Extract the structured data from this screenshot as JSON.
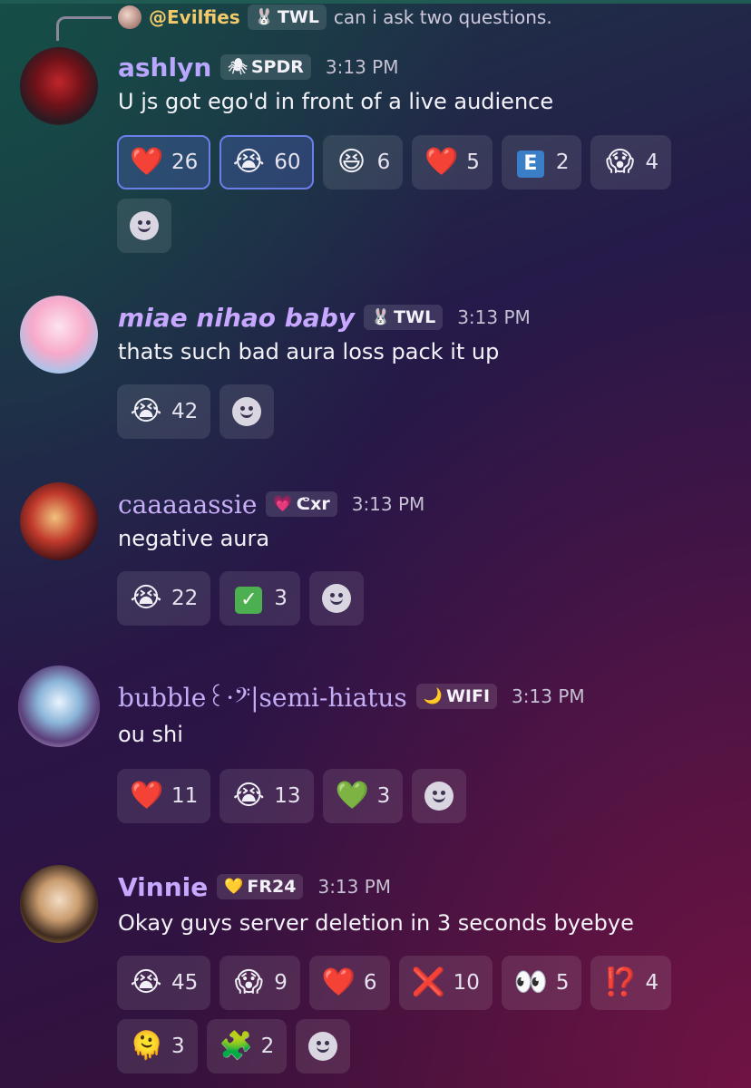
{
  "reply": {
    "username": "@Evilfies",
    "tag": "TWL",
    "tag_icon": "🐰",
    "text": "can i ask two questions."
  },
  "messages": [
    {
      "username": "ashlyn",
      "name_color": "#b9a6ff",
      "tag": "SPDR",
      "tag_icon": "🕷",
      "time": "3:13 PM",
      "text": "U js got ego'd in front of a live audience",
      "reactions": [
        {
          "emoji": "❤️",
          "icon": "red-heart",
          "count": "26",
          "active": true
        },
        {
          "emoji": "😭",
          "icon": "loudly-crying-face",
          "count": "60",
          "active": true
        },
        {
          "emoji": "😆",
          "icon": "grinning-squinting-face",
          "count": "6"
        },
        {
          "emoji": "❤️",
          "icon": "red-heart",
          "count": "5"
        },
        {
          "emoji": "E",
          "icon": "letter-e-badge",
          "count": "2"
        },
        {
          "emoji": "😱",
          "icon": "screaming-face",
          "count": "4"
        }
      ]
    },
    {
      "username": "miae nihao baby",
      "name_color": "#c7a7ff",
      "tag": "TWL",
      "tag_icon": "🐰",
      "time": "3:13 PM",
      "text": "thats such bad aura loss pack it up",
      "reactions": [
        {
          "emoji": "😭",
          "icon": "loudly-crying-face",
          "count": "42"
        }
      ]
    },
    {
      "username": "caaaaassie",
      "name_color": "#c8aef7",
      "tag": "ᕦxr",
      "tag_icon": "💗",
      "time": "3:13 PM",
      "text": "negative aura",
      "reactions": [
        {
          "emoji": "😭",
          "icon": "loudly-crying-face",
          "count": "22"
        },
        {
          "emoji": "✓",
          "icon": "check-mark-button",
          "count": "3"
        }
      ]
    },
    {
      "username": "bubble꒰·𝄢|semi-hiatus",
      "name_color": "#c3aef5",
      "tag": "WIFI",
      "tag_icon": "🌙",
      "time": "3:13 PM",
      "text": "ou shi",
      "reactions": [
        {
          "emoji": "❤️",
          "icon": "red-heart",
          "count": "11"
        },
        {
          "emoji": "😭",
          "icon": "loudly-crying-face",
          "count": "13"
        },
        {
          "emoji": "💚",
          "icon": "green-heart",
          "count": "3"
        }
      ]
    },
    {
      "username": "Vinnie",
      "name_color": "#c6a8ff",
      "tag": "FR24",
      "tag_icon": "💛",
      "time": "3:13 PM",
      "text": "Okay guys server deletion in 3 seconds byebye",
      "reactions": [
        {
          "emoji": "😭",
          "icon": "loudly-crying-face",
          "count": "45"
        },
        {
          "emoji": "😱",
          "icon": "screaming-face",
          "count": "9"
        },
        {
          "emoji": "❤️",
          "icon": "red-heart",
          "count": "6"
        },
        {
          "emoji": "❌",
          "icon": "cross-mark",
          "count": "10"
        },
        {
          "emoji": "👀",
          "icon": "eyes",
          "count": "5"
        },
        {
          "emoji": "⁉️",
          "icon": "exclamation-question-mark",
          "count": "4"
        },
        {
          "emoji": "🫠",
          "icon": "melting-face",
          "count": "3"
        },
        {
          "emoji": "🧩",
          "icon": "custom-image-emoji",
          "count": "2"
        }
      ]
    }
  ]
}
